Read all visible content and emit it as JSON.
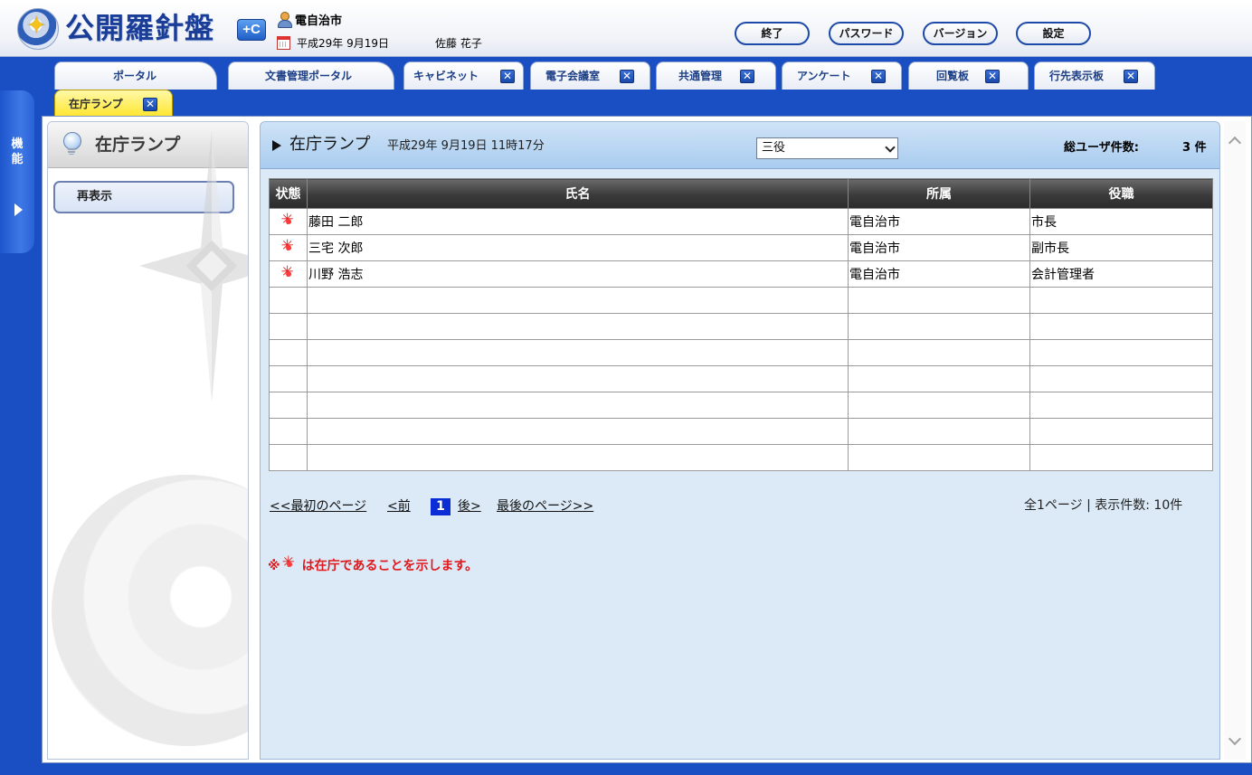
{
  "header": {
    "logo_text": "公開羅針盤",
    "logo_badge": "+C",
    "org_name": "電自治市",
    "date": "平成29年 9月19日",
    "user_name": "佐藤 花子",
    "buttons": {
      "exit": "終了",
      "password": "パスワード",
      "version": "バージョン",
      "settings": "設定"
    }
  },
  "tabs": [
    {
      "label": "ポータル",
      "closable": false
    },
    {
      "label": "文書管理ポータル",
      "closable": false
    },
    {
      "label": "キャビネット",
      "closable": true
    },
    {
      "label": "電子会議室",
      "closable": true
    },
    {
      "label": "共通管理",
      "closable": true
    },
    {
      "label": "アンケート",
      "closable": true
    },
    {
      "label": "回覧板",
      "closable": true
    },
    {
      "label": "行先表示板",
      "closable": true
    },
    {
      "label": "在庁ランプ",
      "closable": true,
      "active": true
    }
  ],
  "close_glyph": "✕",
  "side_strip": {
    "label": "機能"
  },
  "side_panel": {
    "title": "在庁ランプ",
    "refresh_button": "再表示"
  },
  "main": {
    "title": "在庁ランプ",
    "datetime": "平成29年 9月19日  11時17分",
    "filter_selected": "三役",
    "total_label": "総ユーザ件数:",
    "total_value": "3 件",
    "columns": [
      "状態",
      "氏名",
      "所属",
      "役職"
    ],
    "rows": [
      {
        "status": "present",
        "name": "藤田 二郎",
        "dept": "電自治市",
        "title": "市長"
      },
      {
        "status": "present",
        "name": "三宅 次郎",
        "dept": "電自治市",
        "title": "副市長"
      },
      {
        "status": "present",
        "name": "川野 浩志",
        "dept": "電自治市",
        "title": "会計管理者"
      },
      {
        "status": "",
        "name": "",
        "dept": "",
        "title": ""
      },
      {
        "status": "",
        "name": "",
        "dept": "",
        "title": ""
      },
      {
        "status": "",
        "name": "",
        "dept": "",
        "title": ""
      },
      {
        "status": "",
        "name": "",
        "dept": "",
        "title": ""
      },
      {
        "status": "",
        "name": "",
        "dept": "",
        "title": ""
      },
      {
        "status": "",
        "name": "",
        "dept": "",
        "title": ""
      },
      {
        "status": "",
        "name": "",
        "dept": "",
        "title": ""
      }
    ],
    "pager": {
      "first": "<<最初のページ",
      "prev": "<前",
      "current": "1",
      "next": "後>",
      "last": "最後のページ>>",
      "info": "全1ページ | 表示件数: 10件"
    },
    "legend": {
      "prefix": "※",
      "text": "は在庁であることを示します。"
    }
  },
  "colors": {
    "frame_blue": "#1a4fc4",
    "lamp_red": "#e01b1b",
    "active_tab": "#ffe52e",
    "legend_red": "#e0171b"
  }
}
